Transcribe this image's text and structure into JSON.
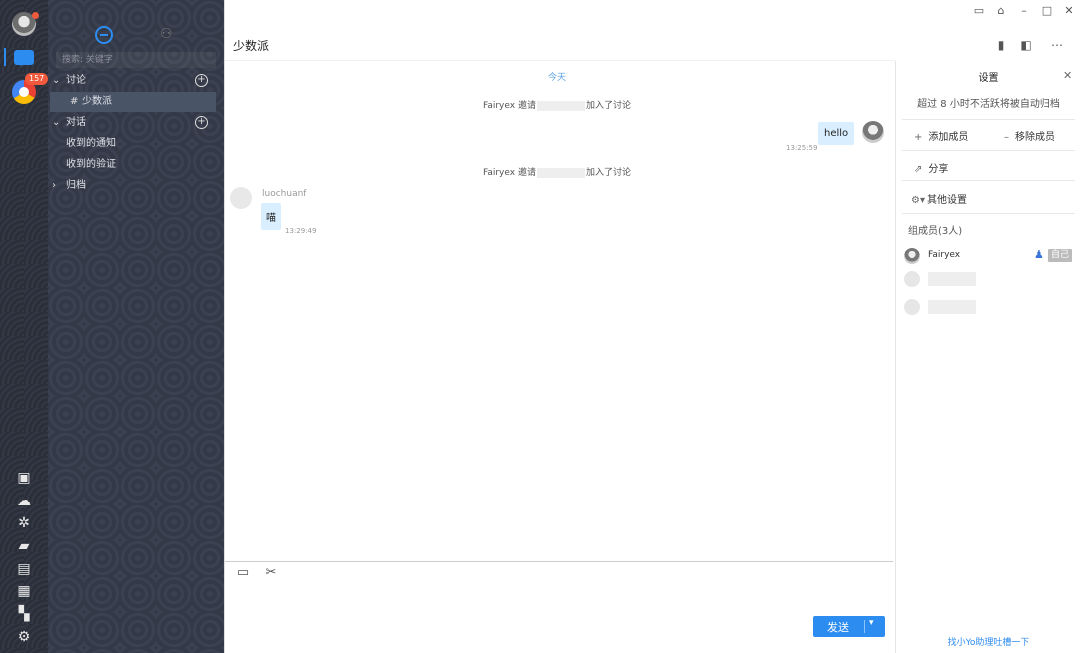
{
  "rail": {
    "unread_badge": "157",
    "tools": [
      "trello-icon",
      "wechat-icon",
      "settings-gear-icon",
      "cloud-folder-icon",
      "notebook-icon",
      "calendar-icon",
      "apps-grid-icon",
      "preferences-icon"
    ]
  },
  "sidebar": {
    "search_placeholder": "搜索: 关键字",
    "groups": [
      {
        "label": "讨论",
        "expanded": true
      },
      {
        "label": "对话",
        "expanded": true
      },
      {
        "label": "归档",
        "expanded": false
      }
    ],
    "items": {
      "discussion_channel": "少数派",
      "received_notices": "收到的通知",
      "received_verifications": "收到的验证"
    },
    "hash": "#"
  },
  "chat": {
    "title": "少数派",
    "today_label": "今天",
    "system_messages": [
      {
        "inviter": "Fairyex",
        "verb": "邀请",
        "suffix": "加入了讨论"
      },
      {
        "inviter": "Fairyex",
        "verb": "邀请",
        "suffix": "加入了讨论"
      }
    ],
    "messages": [
      {
        "from": "me",
        "text": "hello",
        "time": "13:25:59"
      },
      {
        "from": "luochuanf",
        "text": "喵",
        "time": "13:29:49"
      }
    ],
    "sender_name": "luochuanf",
    "send_label": "发送",
    "caret": "▾"
  },
  "settings": {
    "title": "设置",
    "archive_note": "超过 8 小时不活跃将被自动归档",
    "add_member": "添加成员",
    "remove_member": "移除成员",
    "share": "分享",
    "other_settings": "其他设置",
    "members_title": "组成员(3人)",
    "members": [
      {
        "name": "Fairyex",
        "self_tag": "自己"
      }
    ],
    "feedback_link": "找小Yo助理吐槽一下"
  },
  "colors": {
    "accent": "#2d8cf0",
    "bubble": "#d9efff",
    "sidebar_bg": "#343947",
    "badge": "#f05a3c"
  }
}
